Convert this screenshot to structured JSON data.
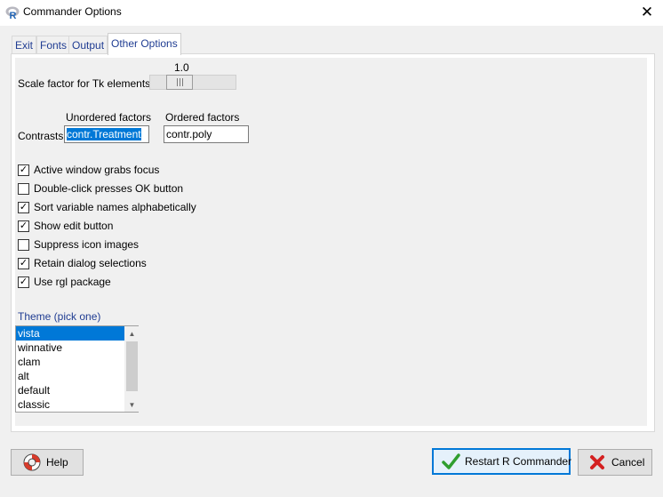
{
  "window": {
    "title": "Commander Options",
    "close_glyph": "✕"
  },
  "tabs": [
    {
      "label": "Exit"
    },
    {
      "label": "Fonts"
    },
    {
      "label": "Output"
    },
    {
      "label": "Other Options",
      "active": true
    }
  ],
  "scale": {
    "label": "Scale factor for Tk elements",
    "value": "1.0"
  },
  "contrasts": {
    "label": "Contrasts",
    "unordered_header": "Unordered factors",
    "ordered_header": "Ordered factors",
    "unordered_value": "contr.Treatment",
    "ordered_value": "contr.poly"
  },
  "options": [
    {
      "label": "Active window grabs focus",
      "checked": true
    },
    {
      "label": "Double-click presses OK button",
      "checked": false
    },
    {
      "label": "Sort variable names alphabetically",
      "checked": true
    },
    {
      "label": "Show edit button",
      "checked": true
    },
    {
      "label": "Suppress icon images",
      "checked": false
    },
    {
      "label": "Retain dialog selections",
      "checked": true
    },
    {
      "label": "Use rgl package",
      "checked": true
    }
  ],
  "theme": {
    "label": "Theme (pick one)",
    "items": [
      "vista",
      "winnative",
      "clam",
      "alt",
      "default",
      "classic"
    ],
    "selected": "vista"
  },
  "buttons": {
    "help": "Help",
    "restart": "Restart R Commander",
    "cancel": "Cancel"
  },
  "icons": {
    "app": "r-logo-icon",
    "help": "lifebuoy-icon",
    "restart": "green-checkmark-icon",
    "cancel": "red-x-icon"
  },
  "colors": {
    "accent": "#0078d7",
    "label_blue": "#1f3c92",
    "background": "#f0f0f0"
  }
}
